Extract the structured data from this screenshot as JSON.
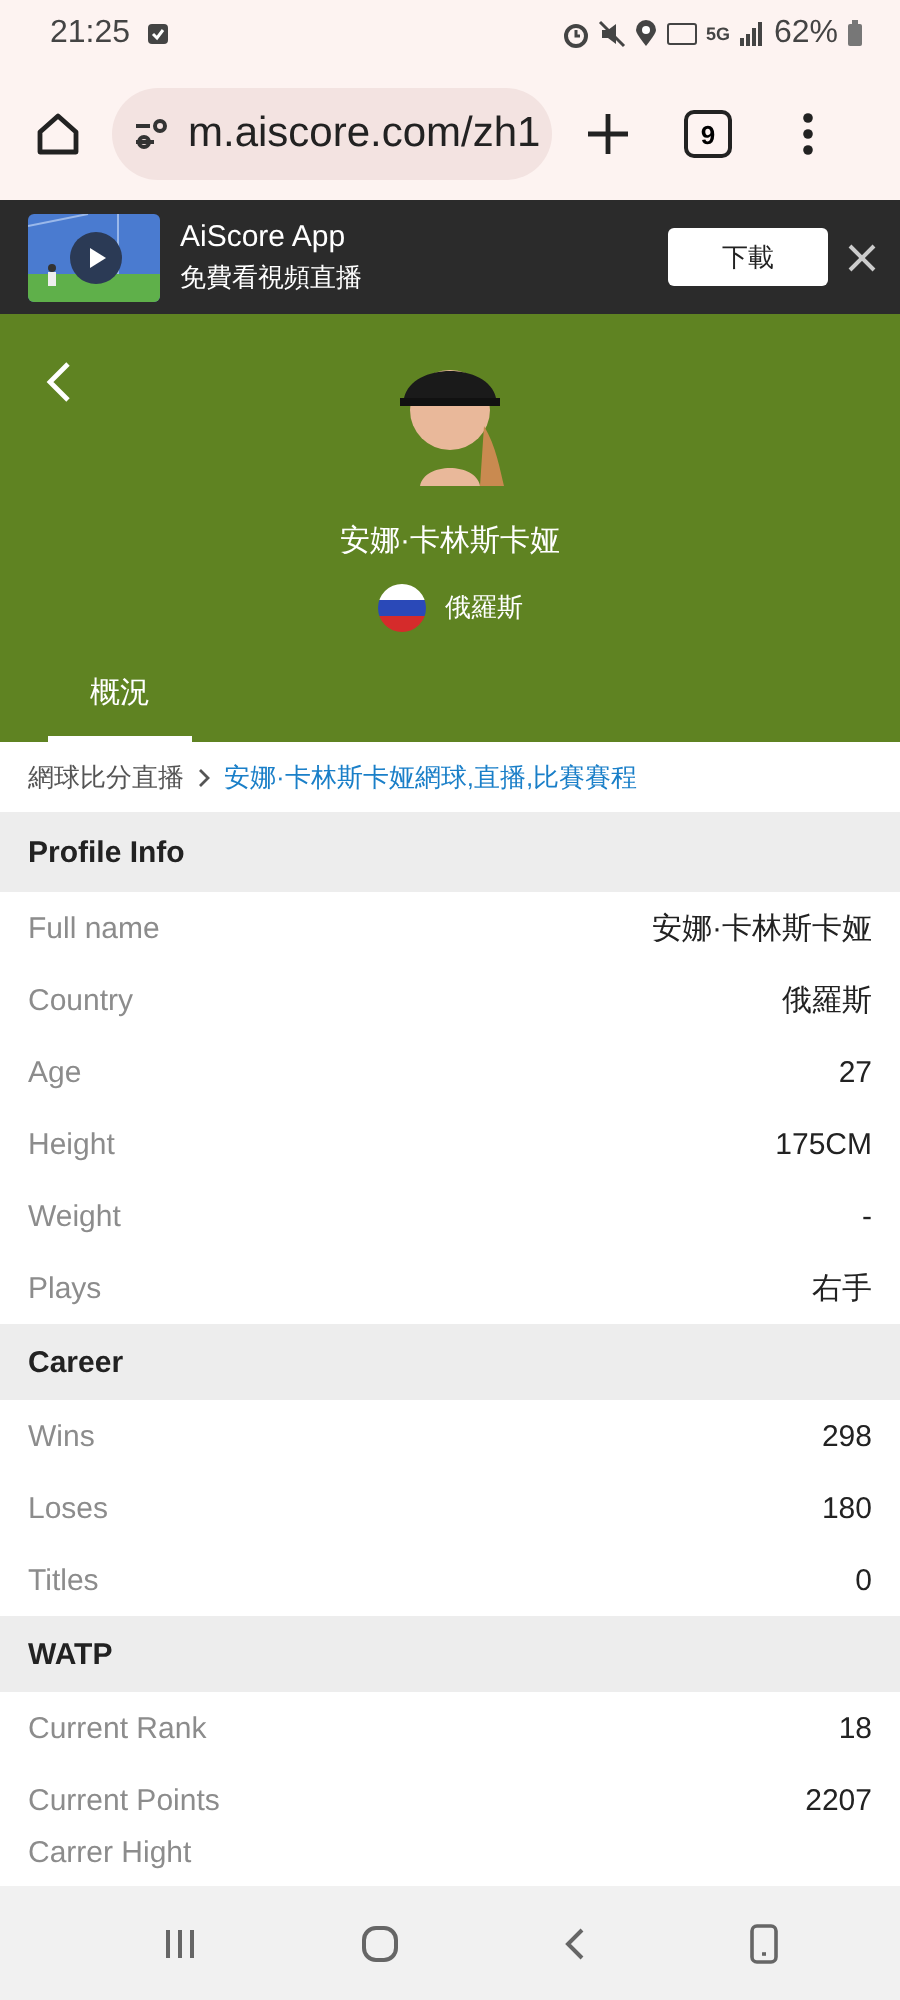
{
  "status_bar": {
    "time": "21:25",
    "network": "5G",
    "battery": "62%"
  },
  "browser": {
    "url": "m.aiscore.com/zh1",
    "tab_count": "9"
  },
  "app_banner": {
    "title": "AiScore App",
    "subtitle": "免費看視頻直播",
    "button": "下載"
  },
  "player": {
    "name": "安娜·卡林斯卡娅",
    "country": "俄羅斯"
  },
  "tabs": [
    {
      "label": "概況",
      "selected": true
    }
  ],
  "breadcrumb": [
    {
      "text": "網球比分直播",
      "kind": "plain"
    },
    {
      "text": "安娜·卡林斯卡娅網球,直播,比賽賽程",
      "kind": "link"
    }
  ],
  "sections": [
    {
      "title": "Profile Info",
      "rows": [
        {
          "label": "Full name",
          "value": "安娜·卡林斯卡娅"
        },
        {
          "label": "Country",
          "value": "俄羅斯"
        },
        {
          "label": "Age",
          "value": "27"
        },
        {
          "label": "Height",
          "value": "175CM"
        },
        {
          "label": "Weight",
          "value": "-"
        },
        {
          "label": "Plays",
          "value": "右手"
        }
      ]
    },
    {
      "title": "Career",
      "rows": [
        {
          "label": "Wins",
          "value": "298"
        },
        {
          "label": "Loses",
          "value": "180"
        },
        {
          "label": "Titles",
          "value": "0"
        }
      ]
    },
    {
      "title": "WATP",
      "rows": [
        {
          "label": "Current Rank",
          "value": "18"
        },
        {
          "label": "Current Points",
          "value": "2207"
        },
        {
          "label": "Carrer Hight"
        }
      ]
    }
  ]
}
